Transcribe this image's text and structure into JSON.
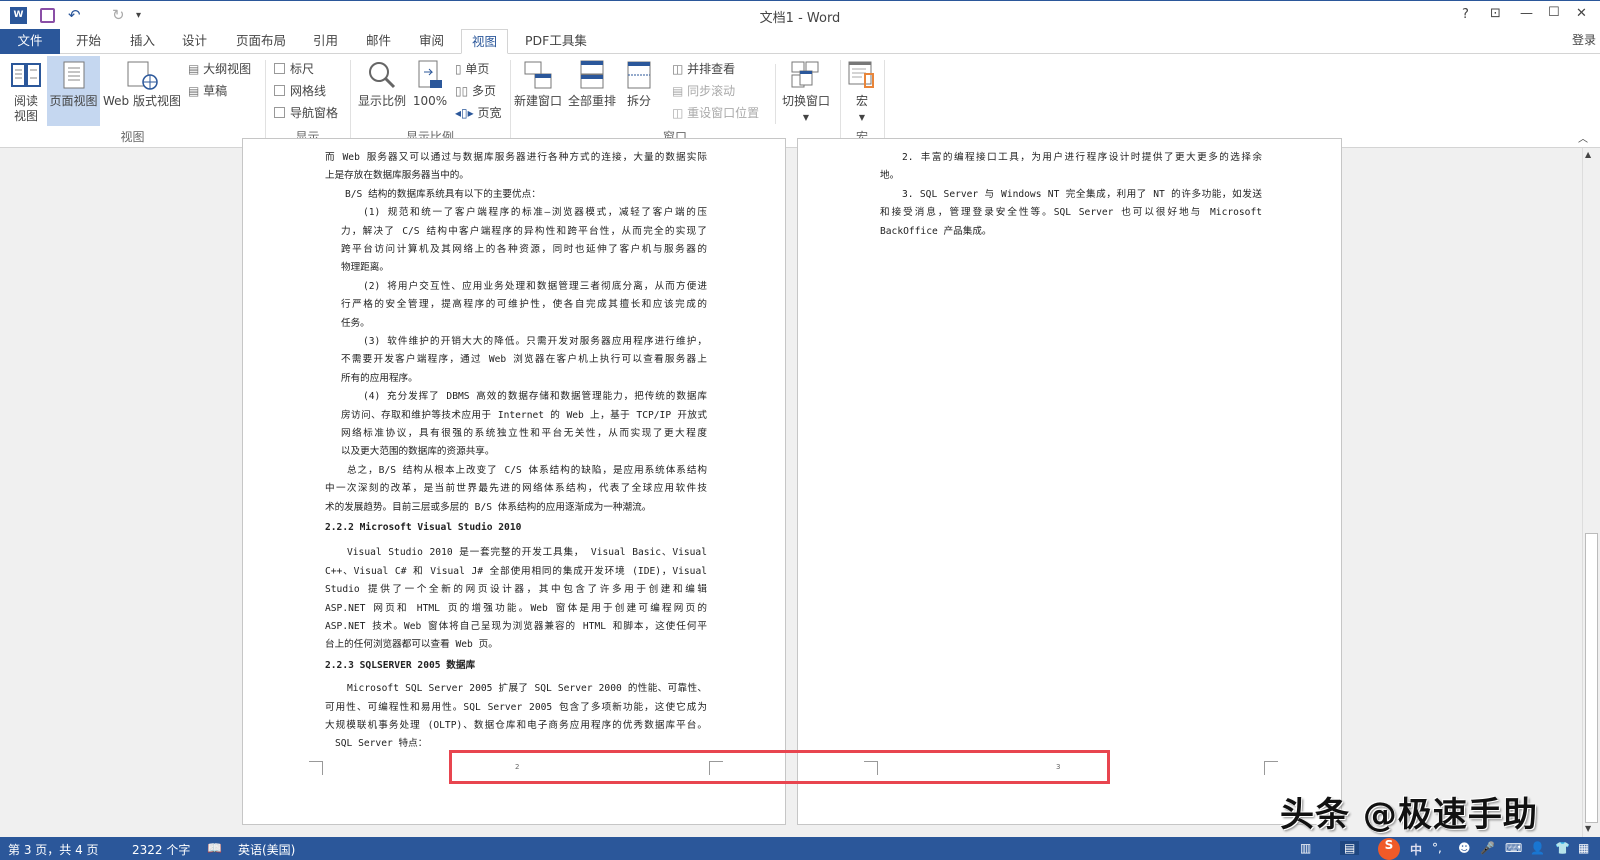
{
  "window": {
    "title": "文档1 - Word",
    "help": "?",
    "restore_ribbon": "⊡",
    "minimize": "—",
    "maximize": "☐",
    "close": "✕",
    "signin": "登录"
  },
  "quick_access": {
    "undo": "↶",
    "redo": "↻",
    "customize": "▾"
  },
  "tabs": [
    {
      "label": "文件"
    },
    {
      "label": "开始"
    },
    {
      "label": "插入"
    },
    {
      "label": "设计"
    },
    {
      "label": "页面布局"
    },
    {
      "label": "引用"
    },
    {
      "label": "邮件"
    },
    {
      "label": "审阅"
    },
    {
      "label": "视图",
      "active": true
    },
    {
      "label": "PDF工具集"
    }
  ],
  "ribbon": {
    "views": {
      "group": "视图",
      "read_mode": [
        "阅读",
        "视图"
      ],
      "print_layout": "页面视图",
      "web_layout": "Web 版式视图",
      "outline": "大纲视图",
      "draft": "草稿"
    },
    "show": {
      "group": "显示",
      "ruler": "标尺",
      "gridlines": "网格线",
      "nav_pane": "导航窗格",
      "ruler_checked": false,
      "gridlines_checked": false,
      "nav_pane_checked": false
    },
    "zoom": {
      "group": "显示比例",
      "zoom": "显示比例",
      "zoom100": "100%",
      "one_page": "单页",
      "multi_page": "多页",
      "page_width": "页宽"
    },
    "window": {
      "group": "窗口",
      "new_window": "新建窗口",
      "arrange_all": "全部重排",
      "split": "拆分",
      "side_by_side": "并排查看",
      "sync_scroll": "同步滚动",
      "reset_position": "重设窗口位置",
      "switch_windows": "切换窗口"
    },
    "macros": {
      "group": "宏",
      "macros": "宏"
    }
  },
  "document": {
    "left_page": {
      "page_number": "2",
      "lines": [
        {
          "t": "而 Web 服务器又可以通过与数据库服务器进行各种方式的连接，大量的数据实际",
          "i": 0,
          "j": true
        },
        {
          "t": "上是存放在数据库服务器当中的。",
          "i": 0
        },
        {
          "t": "B/S 结构的数据库系统具有以下的主要优点：",
          "i": 20
        },
        {
          "t": "(1) 规范和统一了客户端程序的标准—浏览器模式，减轻了客户端的压",
          "i": 38,
          "j": true
        },
        {
          "t": "力，解决了 C/S 结构中客户端程序的异构性和跨平台性，从而完全的实现了",
          "i": 16,
          "j": true
        },
        {
          "t": "跨平台访问计算机及其网络上的各种资源，同时也延伸了客户机与服务器的",
          "i": 16,
          "j": true
        },
        {
          "t": "物理距离。",
          "i": 16
        },
        {
          "t": "(2) 将用户交互性、应用业务处理和数据管理三者彻底分离，从而方便进",
          "i": 38,
          "j": true
        },
        {
          "t": "行严格的安全管理，提高程序的可维护性，使各自完成其擅长和应该完成的",
          "i": 16,
          "j": true
        },
        {
          "t": "任务。",
          "i": 16
        },
        {
          "t": "(3) 软件维护的开销大大的降低。只需开发对服务器应用程序进行维护，",
          "i": 38,
          "j": true
        },
        {
          "t": "不需要开发客户端程序，通过 Web 浏览器在客户机上执行可以查看服务器上",
          "i": 16,
          "j": true
        },
        {
          "t": "所有的应用程序。",
          "i": 16
        },
        {
          "t": "(4) 充分发挥了 DBMS 高效的数据存储和数据管理能力，把传统的数据库",
          "i": 38,
          "j": true
        },
        {
          "t": "房访问、存取和维护等技术应用于 Internet 的 Web 上，基于 TCP/IP 开放式",
          "i": 16,
          "j": true
        },
        {
          "t": "网络标准协议，具有很强的系统独立性和平台无关性，从而实现了更大程度",
          "i": 16,
          "j": true
        },
        {
          "t": "以及更大范围的数据库的资源共享。",
          "i": 16
        },
        {
          "t": "总之，B/S 结构从根本上改变了 C/S 体系结构的缺陷，是应用系统体系结构",
          "i": 22,
          "j": true
        },
        {
          "t": "中一次深刻的改革，是当前世界最先进的网络体系结构，代表了全球应用软件技",
          "i": 0,
          "j": true
        },
        {
          "t": "术的发展趋势。目前三层或多层的 B/S 体系结构的应用逐渐成为一种潮流。",
          "i": 0
        },
        {
          "t": "2.2.2 Microsoft Visual Studio 2010",
          "i": 0,
          "b": true,
          "gap": 2
        },
        {
          "t": "Visual  Studio  2010 是一套完整的开发工具集， Visual  Basic、Visual",
          "i": 22,
          "j": true,
          "gap": 7
        },
        {
          "t": "C++、Visual  C#  和  Visual  J#  全部使用相同的集成开发环境 (IDE)，Visual",
          "i": 0,
          "j": true
        },
        {
          "t": "Studio  提供了一个全新的网页设计器，其中包含了许多用于创建和编辑",
          "i": 0,
          "j": true
        },
        {
          "t": "ASP.NET  网页和  HTML  页的增强功能。Web  窗体是用于创建可编程网页的",
          "i": 0,
          "j": true
        },
        {
          "t": "ASP.NET 技术。Web 窗体将自己呈现为浏览器兼容的 HTML 和脚本，这使任何平",
          "i": 0,
          "j": true
        },
        {
          "t": "台上的任何浏览器都可以查看 Web 页。",
          "i": 0
        },
        {
          "t": "2.2.3 SQLSERVER 2005 数据库",
          "i": 0,
          "b": true,
          "gap": 2
        },
        {
          "t": "Microsoft SQL Server 2005 扩展了 SQL Server 2000 的性能、可靠性、",
          "i": 22,
          "j": true,
          "gap": 5
        },
        {
          "t": "可用性、可编程性和易用性。SQL Server 2005 包含了多项新功能，这使它成为",
          "i": 0,
          "j": true
        },
        {
          "t": "大规模联机事务处理 (OLTP)、数据仓库和电子商务应用程序的优秀数据库平台。",
          "i": 0,
          "j": true
        },
        {
          "t": "SQL Server 特点：",
          "i": 10
        }
      ]
    },
    "right_page": {
      "page_number": "3",
      "lines": [
        {
          "t": "2. 丰富的编程接口工具，为用户进行程序设计时提供了更大更多的选择余",
          "i": 22,
          "j": true
        },
        {
          "t": "地。",
          "i": 0
        },
        {
          "t": "3.  SQL Server 与 Windows NT 完全集成，利用了 NT 的许多功能，如发送",
          "i": 22,
          "j": true
        },
        {
          "t": "和接受消息，管理登录安全性等。SQL  Server  也可以很好地与 Microsoft",
          "i": 0,
          "j": true
        },
        {
          "t": "BackOffice 产品集成。",
          "i": 0
        }
      ]
    }
  },
  "status": {
    "page": "第 3 页，共 4 页",
    "words": "2322 个字",
    "language": "英语(美国)"
  },
  "ime": {
    "lang": "中",
    "punct": "°,"
  },
  "watermark": "头条 @极速手助",
  "colors": {
    "accent": "#2b579a",
    "highlight_box": "#e8454f",
    "active_view": "#c5d7f0"
  }
}
